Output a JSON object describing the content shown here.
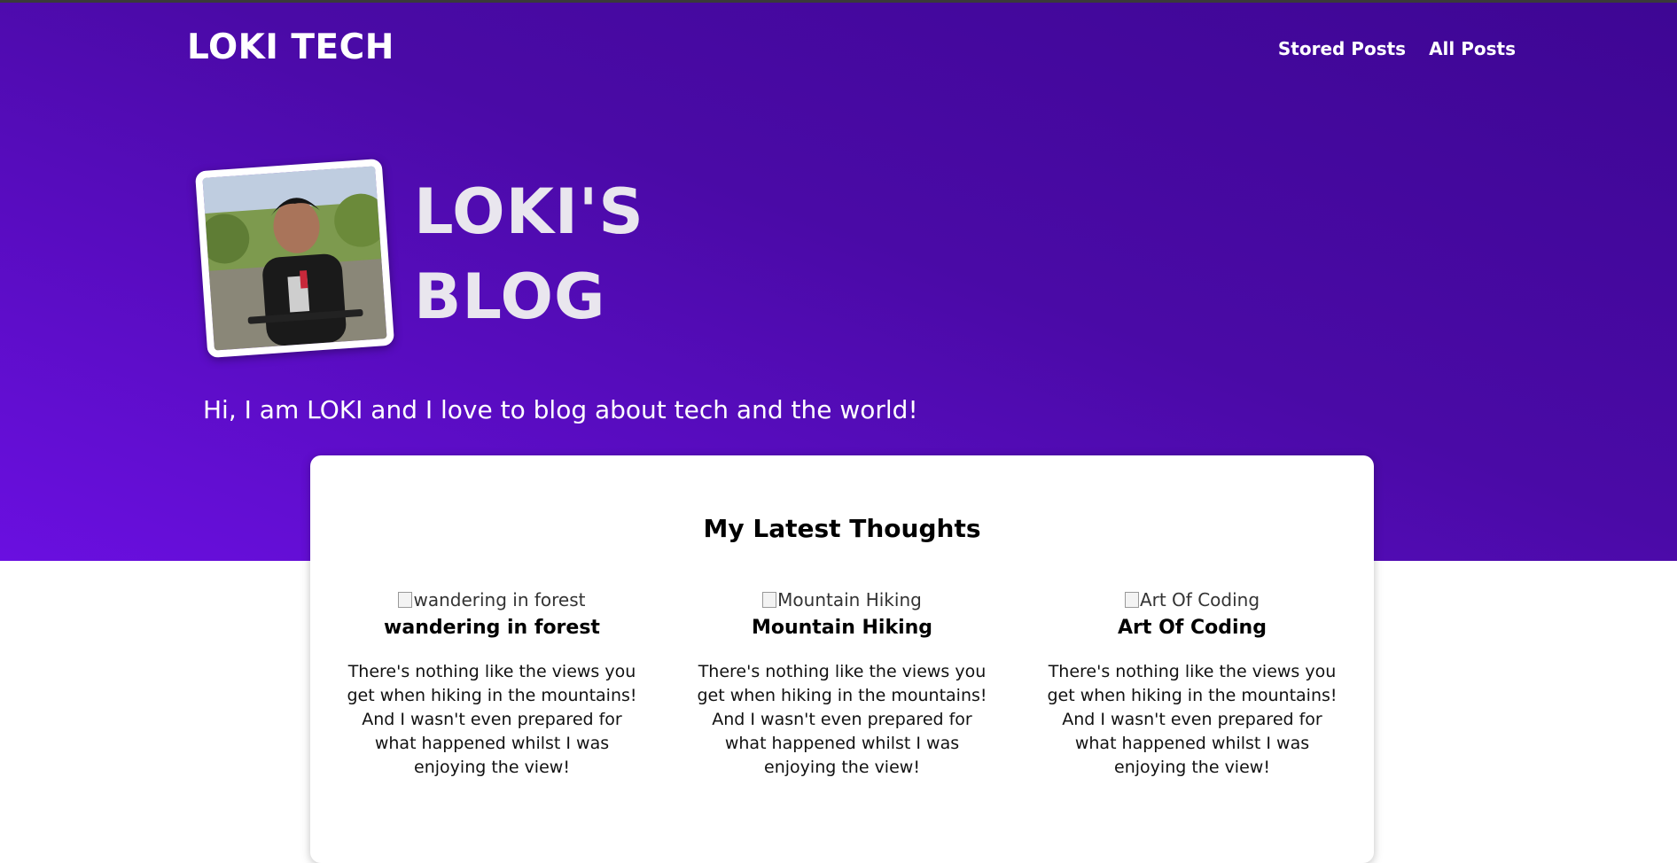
{
  "header": {
    "brand": "LOKI TECH",
    "nav": [
      {
        "label": "Stored Posts"
      },
      {
        "label": "All Posts"
      }
    ]
  },
  "hero": {
    "title": "LOKI'S BLOG",
    "intro": "Hi, I am LOKI and I love to blog about tech and the world!"
  },
  "latest": {
    "heading": "My Latest Thoughts",
    "posts": [
      {
        "image_alt": "wandering in forest",
        "title": "wandering in forest",
        "excerpt": "There's nothing like the views you get when hiking in the mountains! And I wasn't even prepared for what happened whilst I was enjoying the view!"
      },
      {
        "image_alt": "Mountain Hiking",
        "title": "Mountain Hiking",
        "excerpt": "There's nothing like the views you get when hiking in the mountains! And I wasn't even prepared for what happened whilst I was enjoying the view!"
      },
      {
        "image_alt": "Art Of Coding",
        "title": "Art Of Coding",
        "excerpt": "There's nothing like the views you get when hiking in the mountains! And I wasn't even prepared for what happened whilst I was enjoying the view!"
      }
    ]
  },
  "colors": {
    "hero_gradient_top": "#3e0694",
    "hero_gradient_bottom": "#6a0fe0",
    "title_text": "#e9e6ee"
  }
}
